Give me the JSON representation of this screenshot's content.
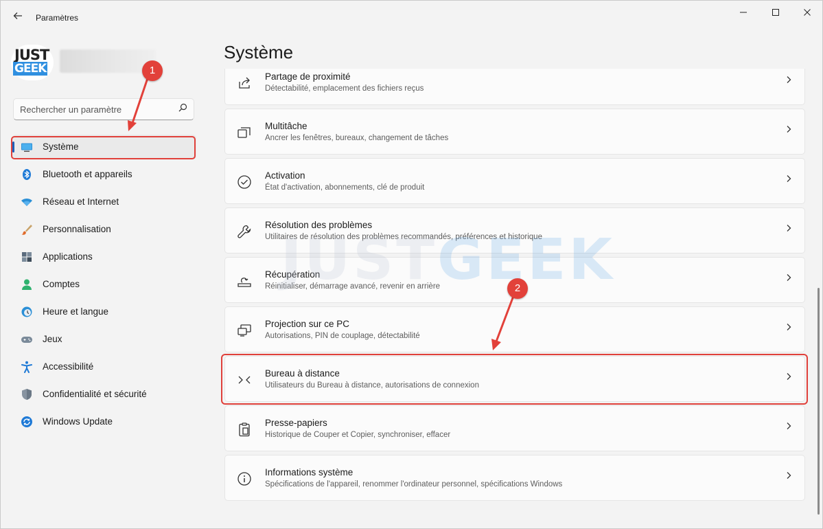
{
  "window": {
    "title": "Paramètres",
    "back_icon": "arrow-left-icon",
    "controls": {
      "minimize": "—",
      "maximize": "☐",
      "close": "✕"
    }
  },
  "profile": {
    "logo_line1": "JUST",
    "logo_line2": "GEEK"
  },
  "search": {
    "placeholder": "Rechercher un paramètre",
    "value": ""
  },
  "sidebar": {
    "items": [
      {
        "label": "Système",
        "icon": "monitor-icon",
        "active": true
      },
      {
        "label": "Bluetooth et appareils",
        "icon": "bluetooth-icon"
      },
      {
        "label": "Réseau et Internet",
        "icon": "wifi-icon"
      },
      {
        "label": "Personnalisation",
        "icon": "brush-icon"
      },
      {
        "label": "Applications",
        "icon": "apps-icon"
      },
      {
        "label": "Comptes",
        "icon": "user-icon"
      },
      {
        "label": "Heure et langue",
        "icon": "clock-globe-icon"
      },
      {
        "label": "Jeux",
        "icon": "gamepad-icon"
      },
      {
        "label": "Accessibilité",
        "icon": "accessibility-icon"
      },
      {
        "label": "Confidentialité et sécurité",
        "icon": "shield-icon"
      },
      {
        "label": "Windows Update",
        "icon": "update-icon"
      }
    ]
  },
  "main": {
    "title": "Système",
    "cards": [
      {
        "title": "Partage de proximité",
        "subtitle": "Détectabilité, emplacement des fichiers reçus",
        "icon": "share-icon"
      },
      {
        "title": "Multitâche",
        "subtitle": "Ancrer les fenêtres, bureaux, changement de tâches",
        "icon": "multitask-icon"
      },
      {
        "title": "Activation",
        "subtitle": "État d'activation, abonnements, clé de produit",
        "icon": "check-circle-icon"
      },
      {
        "title": "Résolution des problèmes",
        "subtitle": "Utilitaires de résolution des problèmes recommandés, préférences et historique",
        "icon": "wrench-icon"
      },
      {
        "title": "Récupération",
        "subtitle": "Réinitialiser, démarrage avancé, revenir en arrière",
        "icon": "recovery-icon"
      },
      {
        "title": "Projection sur ce PC",
        "subtitle": "Autorisations, PIN de couplage, détectabilité",
        "icon": "projection-icon"
      },
      {
        "title": "Bureau à distance",
        "subtitle": "Utilisateurs du Bureau à distance, autorisations de connexion",
        "icon": "remote-desktop-icon"
      },
      {
        "title": "Presse-papiers",
        "subtitle": "Historique de Couper et Copier, synchroniser, effacer",
        "icon": "clipboard-icon"
      },
      {
        "title": "Informations système",
        "subtitle": "Spécifications de l'appareil, renommer l'ordinateur personnel, spécifications Windows",
        "icon": "info-icon"
      }
    ]
  },
  "annotations": {
    "badge1": "1",
    "badge2": "2",
    "color": "#e2413a"
  },
  "watermark": {
    "part1": "JUST",
    "part2": "GEEK"
  },
  "colors": {
    "accent": "#1d5fb8",
    "background": "#f3f3f3",
    "card": "#fbfbfb"
  }
}
